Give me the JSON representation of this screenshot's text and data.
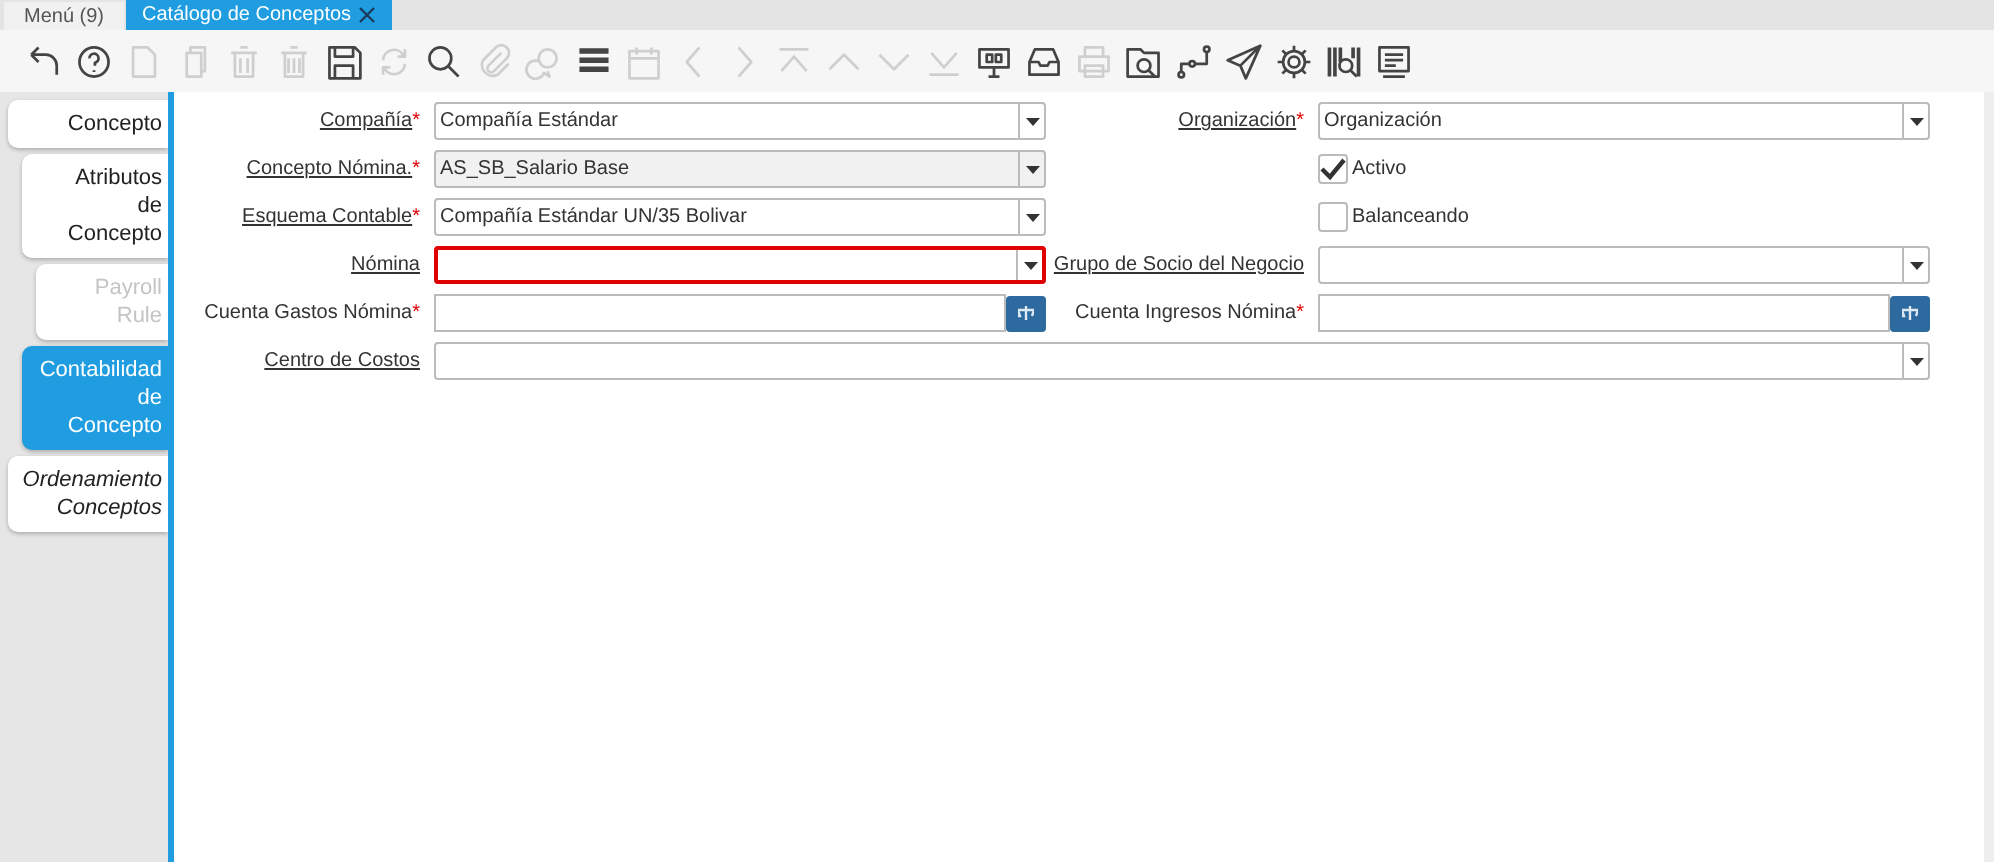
{
  "window_tabs": [
    {
      "label": "Menú (9)",
      "selected": false,
      "closable": false
    },
    {
      "label": "Catálogo de Conceptos",
      "selected": true,
      "closable": true
    }
  ],
  "toolbar": [
    {
      "kind": "undo",
      "disabled": false
    },
    {
      "kind": "help",
      "disabled": false
    },
    {
      "kind": "new",
      "disabled": true
    },
    {
      "kind": "copy",
      "disabled": true
    },
    {
      "kind": "delete",
      "disabled": true
    },
    {
      "kind": "delete-many",
      "disabled": true
    },
    {
      "kind": "save",
      "disabled": false
    },
    {
      "kind": "refresh",
      "disabled": true
    },
    {
      "kind": "search",
      "disabled": false
    },
    {
      "kind": "attach",
      "disabled": true
    },
    {
      "kind": "chat",
      "disabled": true
    },
    {
      "kind": "grid",
      "disabled": false
    },
    {
      "kind": "calendar",
      "disabled": true
    },
    {
      "kind": "prev",
      "disabled": true
    },
    {
      "kind": "next",
      "disabled": true
    },
    {
      "kind": "first",
      "disabled": true
    },
    {
      "kind": "up",
      "disabled": true
    },
    {
      "kind": "down",
      "disabled": true
    },
    {
      "kind": "last",
      "disabled": true
    },
    {
      "kind": "report",
      "disabled": false
    },
    {
      "kind": "archive",
      "disabled": false
    },
    {
      "kind": "print",
      "disabled": true
    },
    {
      "kind": "zoom",
      "disabled": false
    },
    {
      "kind": "workflow",
      "disabled": false
    },
    {
      "kind": "send",
      "disabled": false
    },
    {
      "kind": "gear",
      "disabled": false
    },
    {
      "kind": "barcode",
      "disabled": false
    },
    {
      "kind": "form",
      "disabled": false
    }
  ],
  "side_tabs": [
    {
      "label": "Concepto",
      "selected": false,
      "disabled": false,
      "italic": false,
      "children": [
        {
          "label": "Atributos de Concepto",
          "selected": false,
          "disabled": false,
          "italic": false,
          "children": [
            {
              "label": "Payroll Rule",
              "selected": false,
              "disabled": true,
              "italic": false
            }
          ]
        },
        {
          "label": "Contabilidad de Concepto",
          "selected": true,
          "disabled": false,
          "italic": false
        }
      ]
    },
    {
      "label": "Ordenamiento Conceptos",
      "selected": false,
      "disabled": false,
      "italic": true
    }
  ],
  "form_rows": [
    [
      {
        "kind": "dropdown",
        "label": "Compañía",
        "mark": "*",
        "link": true,
        "value": "Compañía Estándar",
        "readonly": false,
        "error": false
      },
      {
        "kind": "dropdown",
        "label": "Organización",
        "mark": "*",
        "link": true,
        "value": "Organización",
        "readonly": false,
        "error": false
      }
    ],
    [
      {
        "kind": "dropdown",
        "label": "Concepto Nómina.",
        "mark": "*",
        "link": true,
        "value": "AS_SB_Salario Base",
        "readonly": true,
        "error": false
      },
      {
        "kind": "checkbox",
        "label": "Activo",
        "checked": true
      }
    ],
    [
      {
        "kind": "dropdown",
        "label": "Esquema Contable",
        "mark": "*",
        "link": true,
        "value": "Compañía Estándar UN/35 Bolivar",
        "readonly": false,
        "error": false
      },
      {
        "kind": "checkbox",
        "label": "Balanceando",
        "checked": false
      }
    ],
    [
      {
        "kind": "dropdown",
        "label": "Nómina",
        "link": true,
        "readonly": false,
        "error": true
      },
      {
        "kind": "dropdown",
        "label": "Grupo de Socio del Negocio",
        "link": true,
        "readonly": false,
        "error": false
      }
    ],
    [
      {
        "kind": "lookup",
        "label": "Cuenta Gastos Nómina",
        "mark": "*",
        "link": false
      },
      {
        "kind": "lookup",
        "label": "Cuenta Ingresos Nómina",
        "mark": "*",
        "link": false
      }
    ],
    [
      {
        "kind": "wide-dropdown",
        "label": "Centro de Costos",
        "link": true,
        "readonly": false,
        "error": false
      }
    ]
  ]
}
